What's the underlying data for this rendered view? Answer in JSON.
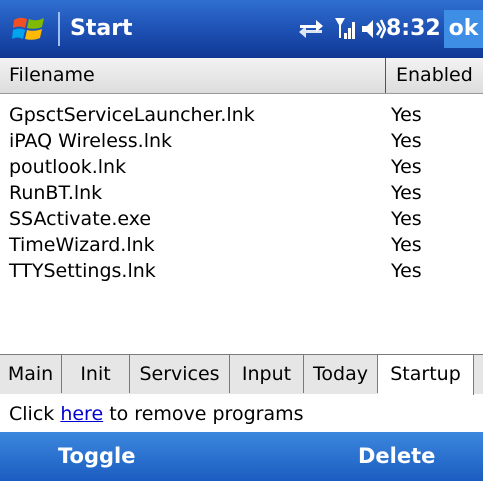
{
  "titlebar": {
    "title": "Start",
    "time": "8:32",
    "ok_label": "ok"
  },
  "columns": {
    "filename": "Filename",
    "enabled": "Enabled"
  },
  "rows": [
    {
      "filename": "GpsctServiceLauncher.lnk",
      "enabled": "Yes"
    },
    {
      "filename": "iPAQ Wireless.lnk",
      "enabled": "Yes"
    },
    {
      "filename": "poutlook.lnk",
      "enabled": "Yes"
    },
    {
      "filename": "RunBT.lnk",
      "enabled": "Yes"
    },
    {
      "filename": "SSActivate.exe",
      "enabled": "Yes"
    },
    {
      "filename": "TimeWizard.lnk",
      "enabled": "Yes"
    },
    {
      "filename": "TTYSettings.lnk",
      "enabled": "Yes"
    }
  ],
  "tabs": [
    {
      "label": "Main"
    },
    {
      "label": "Init"
    },
    {
      "label": "Services"
    },
    {
      "label": "Input"
    },
    {
      "label": "Today"
    },
    {
      "label": "Startup"
    }
  ],
  "active_tab": "Startup",
  "hint": {
    "before": "Click ",
    "link": "here",
    "after": " to remove programs"
  },
  "softkeys": {
    "left": "Toggle",
    "right": "Delete"
  },
  "colors": {
    "titlebar": "#1d4fb2",
    "softkey_bar": "#2a70d0",
    "link": "#0000d0"
  },
  "icons": {
    "start": "windows-flag-icon",
    "connectivity": "sync-arrows-icon",
    "signal": "signal-strength-icon",
    "volume": "speaker-icon"
  }
}
